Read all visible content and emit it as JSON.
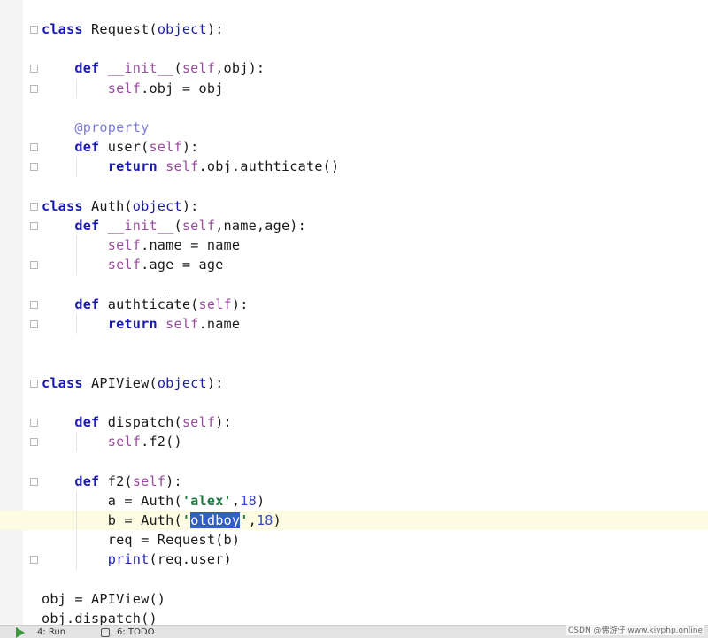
{
  "editor": {
    "lines": [
      {
        "parts": [
          [
            "kw",
            "class"
          ],
          [
            "",
            "&nbsp;Request("
          ],
          [
            "bi",
            "object"
          ],
          [
            "",
            "):"
          ]
        ]
      },
      {
        "parts": []
      },
      {
        "parts": [
          [
            "",
            "    "
          ],
          [
            "kw",
            "def"
          ],
          [
            "",
            "&nbsp;"
          ],
          [
            "slf",
            "__init__"
          ],
          [
            "",
            "("
          ],
          [
            "slf",
            "self"
          ],
          [
            "",
            ",obj):"
          ]
        ]
      },
      {
        "parts": [
          [
            "",
            "        "
          ],
          [
            "slf",
            "self"
          ],
          [
            "",
            ".obj = obj"
          ]
        ]
      },
      {
        "parts": []
      },
      {
        "parts": [
          [
            "",
            "    "
          ],
          [
            "dec",
            "@property"
          ]
        ]
      },
      {
        "parts": [
          [
            "",
            "    "
          ],
          [
            "kw",
            "def"
          ],
          [
            "",
            "&nbsp;user("
          ],
          [
            "slf",
            "self"
          ],
          [
            "",
            "):"
          ]
        ]
      },
      {
        "parts": [
          [
            "",
            "        "
          ],
          [
            "kw",
            "return"
          ],
          [
            "",
            "&nbsp;"
          ],
          [
            "slf",
            "self"
          ],
          [
            "",
            ".obj.authticate()"
          ]
        ]
      },
      {
        "parts": []
      },
      {
        "parts": [
          [
            "kw",
            "class"
          ],
          [
            "",
            "&nbsp;Auth("
          ],
          [
            "bi",
            "object"
          ],
          [
            "",
            "):"
          ]
        ]
      },
      {
        "parts": [
          [
            "",
            "    "
          ],
          [
            "kw",
            "def"
          ],
          [
            "",
            "&nbsp;"
          ],
          [
            "slf",
            "__init__"
          ],
          [
            "",
            "("
          ],
          [
            "slf",
            "self"
          ],
          [
            "",
            ",name,age):"
          ]
        ]
      },
      {
        "parts": [
          [
            "",
            "        "
          ],
          [
            "slf",
            "self"
          ],
          [
            "",
            ".name = name"
          ]
        ]
      },
      {
        "parts": [
          [
            "",
            "        "
          ],
          [
            "slf",
            "self"
          ],
          [
            "",
            ".age = age"
          ]
        ]
      },
      {
        "parts": []
      },
      {
        "parts": [
          [
            "",
            "    "
          ],
          [
            "kw",
            "def"
          ],
          [
            "",
            "&nbsp;authticate("
          ],
          [
            "slf",
            "self"
          ],
          [
            "",
            "):"
          ]
        ]
      },
      {
        "parts": [
          [
            "",
            "        "
          ],
          [
            "kw",
            "return"
          ],
          [
            "",
            "&nbsp;"
          ],
          [
            "slf",
            "self"
          ],
          [
            "",
            ".name"
          ]
        ]
      },
      {
        "parts": []
      },
      {
        "parts": []
      },
      {
        "parts": [
          [
            "kw",
            "class"
          ],
          [
            "",
            "&nbsp;APIView("
          ],
          [
            "bi",
            "object"
          ],
          [
            "",
            "):"
          ]
        ]
      },
      {
        "parts": []
      },
      {
        "parts": [
          [
            "",
            "    "
          ],
          [
            "kw",
            "def"
          ],
          [
            "",
            "&nbsp;dispatch("
          ],
          [
            "slf",
            "self"
          ],
          [
            "",
            "):"
          ]
        ]
      },
      {
        "parts": [
          [
            "",
            "        "
          ],
          [
            "slf",
            "self"
          ],
          [
            "",
            ".f2()"
          ]
        ]
      },
      {
        "parts": []
      },
      {
        "parts": [
          [
            "",
            "    "
          ],
          [
            "kw",
            "def"
          ],
          [
            "",
            "&nbsp;f2("
          ],
          [
            "slf",
            "self"
          ],
          [
            "",
            "):"
          ]
        ]
      },
      {
        "parts": [
          [
            "",
            "        a = Auth("
          ],
          [
            "str",
            "'alex'"
          ],
          [
            "",
            ","
          ],
          [
            "num",
            "18"
          ],
          [
            "",
            ")"
          ]
        ]
      },
      {
        "parts": [
          [
            "",
            "        b = Auth("
          ],
          [
            "str",
            "'"
          ],
          [
            "sel",
            "oldboy"
          ],
          [
            "str",
            "'"
          ],
          [
            "",
            ","
          ],
          [
            "num",
            "18"
          ],
          [
            "",
            ")"
          ]
        ]
      },
      {
        "parts": [
          [
            "",
            "        req = Request(b)"
          ]
        ]
      },
      {
        "parts": [
          [
            "",
            "        "
          ],
          [
            "bi",
            "print"
          ],
          [
            "",
            "(req.user)"
          ]
        ]
      },
      {
        "parts": []
      },
      {
        "parts": [
          [
            "",
            "obj = APIView()"
          ]
        ]
      },
      {
        "parts": [
          [
            "",
            "obj.dispatch()"
          ]
        ]
      }
    ],
    "current_line": 25
  },
  "statusbar": {
    "run_label": "4: Run",
    "todo_label": "6: TODO"
  },
  "watermark": "CSDN @佛游仔 www.kiyphp.online",
  "colors": {
    "keyword": "#1a1ab0",
    "self": "#9a4ca0",
    "decorator": "#7b7bd8",
    "string": "#1e7a3e",
    "number": "#3747c7",
    "selection": "#2f5ec8",
    "current_line": "#fdfce2"
  }
}
